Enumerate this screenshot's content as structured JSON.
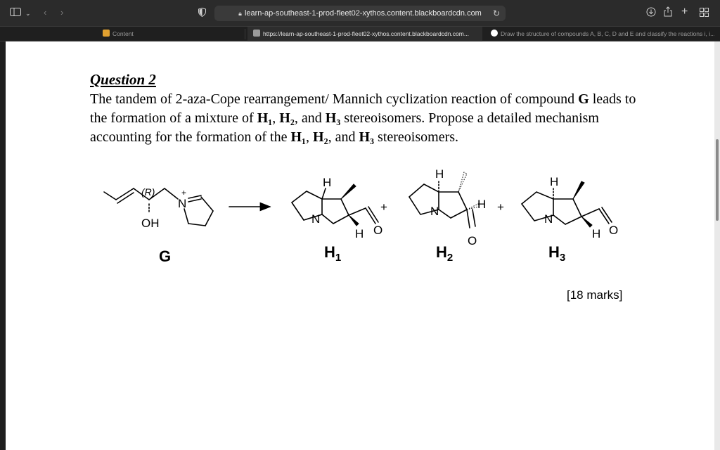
{
  "browser": {
    "url": "learn-ap-southeast-1-prod-fleet02-xythos.content.blackboardcdn.com",
    "icons": [
      "sidebar-icon",
      "chevron-down-icon",
      "back-icon",
      "forward-icon",
      "shield-icon",
      "lock-icon",
      "reload-icon",
      "download-icon",
      "share-icon",
      "new-tab-icon",
      "tab-overview-icon"
    ],
    "tabs": [
      {
        "label": "Content",
        "favicon_color": "#e0a030"
      },
      {
        "label": "https://learn-ap-southeast-1-prod-fleet02-xythos.content.blackboardcdn.com...",
        "favicon_color": "#9a9a9a"
      },
      {
        "label": "Draw the structure of compounds A, B, C, D and E and classify the reactions i, i...",
        "favicon_color": "#ffffff"
      }
    ]
  },
  "question": {
    "title": "Question 2",
    "seg1": "The tandem of 2-aza-Cope rearrangement/ Mannich cyclization reaction of compound ",
    "G": "G",
    "seg2": " leads to the formation of a mixture of ",
    "H1": "H₁",
    "seg3": ", ",
    "H2": "H₂",
    "seg4": ", and ",
    "H3": "H₃",
    "seg5": " stereoisomers. Propose a detailed mechanism accounting for the formation of the ",
    "seg6": ", ",
    "seg7": ", and ",
    "seg8": " stereoisomers.",
    "marks": "[18 marks]"
  },
  "scheme": {
    "r_label": "(R)",
    "n_atom": "N",
    "plus_charge": "+",
    "oh": "OH",
    "h_atom": "H",
    "o_atom": "O",
    "plus": "+",
    "label_g": "G",
    "label_h": "H",
    "sub1": "1",
    "sub2": "2",
    "sub3": "3"
  }
}
